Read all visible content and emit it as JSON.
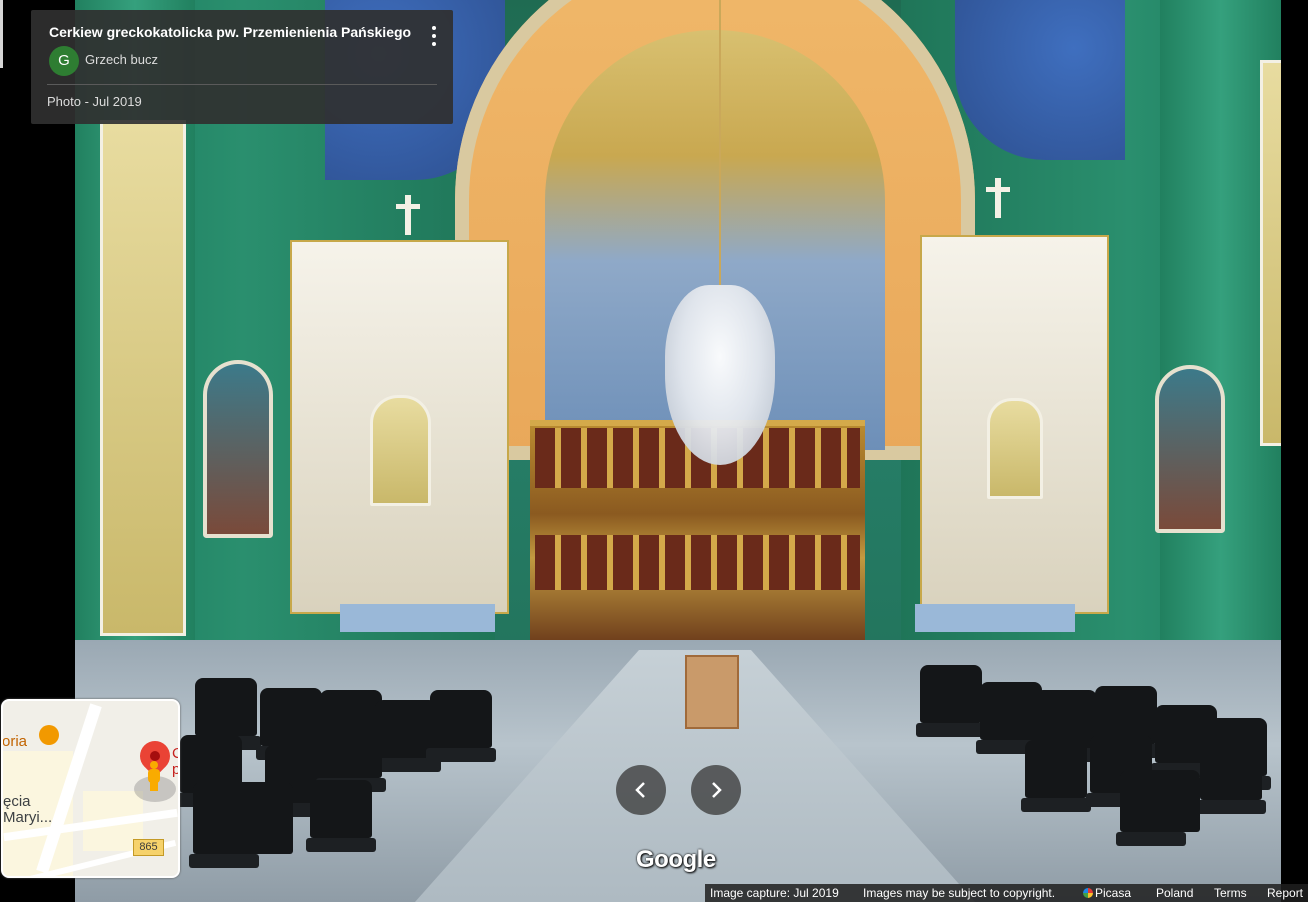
{
  "place": {
    "title": "Cerkiew greckokatolicka pw. Przemienienia Pańskiego",
    "author_initial": "G",
    "author_name": "Grzech bucz",
    "photo_date": "Photo - Jul 2019"
  },
  "navigation": {
    "prev_icon": "chevron-left-icon",
    "next_icon": "chevron-right-icon"
  },
  "branding": {
    "logo_text": "Google"
  },
  "footer": {
    "image_capture": "Image capture: Jul 2019",
    "copyright": "Images may be subject to copyright.",
    "picasa": "Picasa",
    "country": "Poland",
    "terms": "Terms",
    "report": "Report"
  },
  "minimap": {
    "label_restaurant": "oria",
    "label_place": "C\np",
    "label_church": "ęcia\nMaryi...",
    "route_number": "865"
  },
  "colors": {
    "card_bg": "#303030",
    "avatar_green": "#2e7d32",
    "pin_red": "#ea4335",
    "pegman_yellow": "#f9ab00"
  }
}
